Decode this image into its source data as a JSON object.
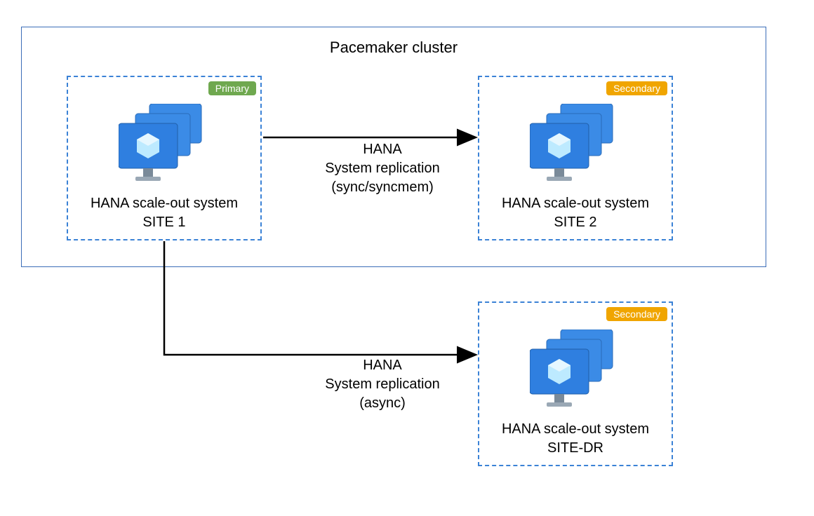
{
  "diagram": {
    "outer_title": "Pacemaker cluster",
    "site1": {
      "badge": "Primary",
      "label_line1": "HANA scale-out system",
      "label_line2": "SITE 1"
    },
    "site2": {
      "badge": "Secondary",
      "label_line1": "HANA scale-out system",
      "label_line2": "SITE 2"
    },
    "site_dr": {
      "badge": "Secondary",
      "label_line1": "HANA scale-out system",
      "label_line2": "SITE-DR"
    },
    "arrow1": {
      "line1": "HANA",
      "line2": "System replication",
      "line3": "(sync/syncmem)"
    },
    "arrow2": {
      "line1": "HANA",
      "line2": "System replication",
      "line3": "(async)"
    }
  }
}
